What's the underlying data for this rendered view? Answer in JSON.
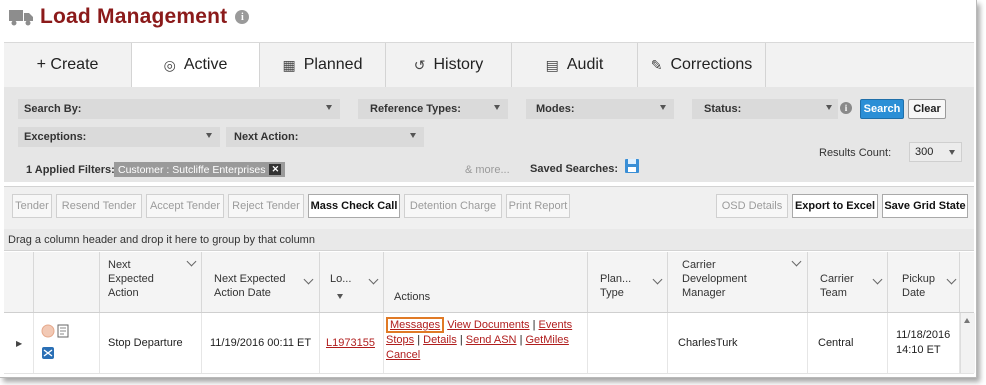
{
  "header": {
    "title": "Load Management",
    "title_icon": "truck-icon",
    "info_icon": "info-icon"
  },
  "tabs": [
    {
      "label": "+ Create",
      "icon": ""
    },
    {
      "label": "Active",
      "icon": "circle-dot-icon"
    },
    {
      "label": "Planned",
      "icon": "calendar-icon"
    },
    {
      "label": "History",
      "icon": "history-icon"
    },
    {
      "label": "Audit",
      "icon": "clipboard-icon"
    },
    {
      "label": "Corrections",
      "icon": "pencil-icon"
    }
  ],
  "filters": {
    "search_by": "Search By:",
    "reference_types": "Reference Types:",
    "modes": "Modes:",
    "status": "Status:",
    "exceptions": "Exceptions:",
    "next_action": "Next Action:",
    "search_button": "Search",
    "clear_button": "Clear",
    "applied_label": "1 Applied Filters:",
    "applied_chip": "Customer : Sutcliffe Enterprises",
    "more_link": "& more...",
    "saved_searches": "Saved Searches:",
    "results_count_label": "Results Count:",
    "results_count_value": "300"
  },
  "toolbar": {
    "tender": "Tender",
    "resend_tender": "Resend Tender",
    "accept_tender": "Accept Tender",
    "reject_tender": "Reject Tender",
    "mass_check_call": "Mass Check Call",
    "detention_charge": "Detention Charge",
    "print_report": "Print Report",
    "osd_details": "OSD Details",
    "export_excel": "Export to Excel",
    "save_grid_state": "Save Grid State"
  },
  "group_bar": "Drag a column header and drop it here to group by that column",
  "grid": {
    "columns": {
      "next_action": [
        "Next",
        "Expected",
        "Action"
      ],
      "next_date": [
        "Next Expected",
        "Action Date"
      ],
      "load": "Lo...",
      "actions": "Actions",
      "plan_type": [
        "Plan...",
        "Type"
      ],
      "carrier_dev": [
        "Carrier",
        "Development",
        "Manager"
      ],
      "carrier_team": [
        "Carrier",
        "Team"
      ],
      "pickup": [
        "Pickup",
        "Date"
      ]
    },
    "rows": [
      {
        "next_action": "Stop Departure",
        "next_date": "11/19/2016 00:11 ET",
        "load": "L1973155",
        "actions": {
          "messages": "Messages",
          "view_documents": "View Documents",
          "events": "Events",
          "stops": "Stops",
          "details": "Details",
          "send_asn": "Send ASN",
          "getmiles": "GetMiles",
          "cancel": "Cancel",
          "sep": "|"
        },
        "plan_type": "",
        "carrier_dev": "CharlesTurk",
        "carrier_team": "Central",
        "pickup_date": "11/18/2016",
        "pickup_time": "14:10 ET"
      }
    ]
  },
  "colors": {
    "title": "#8b1a1a",
    "link": "#b01d1d",
    "search_button": "#2b8fd6",
    "highlight": "#e07a26"
  }
}
